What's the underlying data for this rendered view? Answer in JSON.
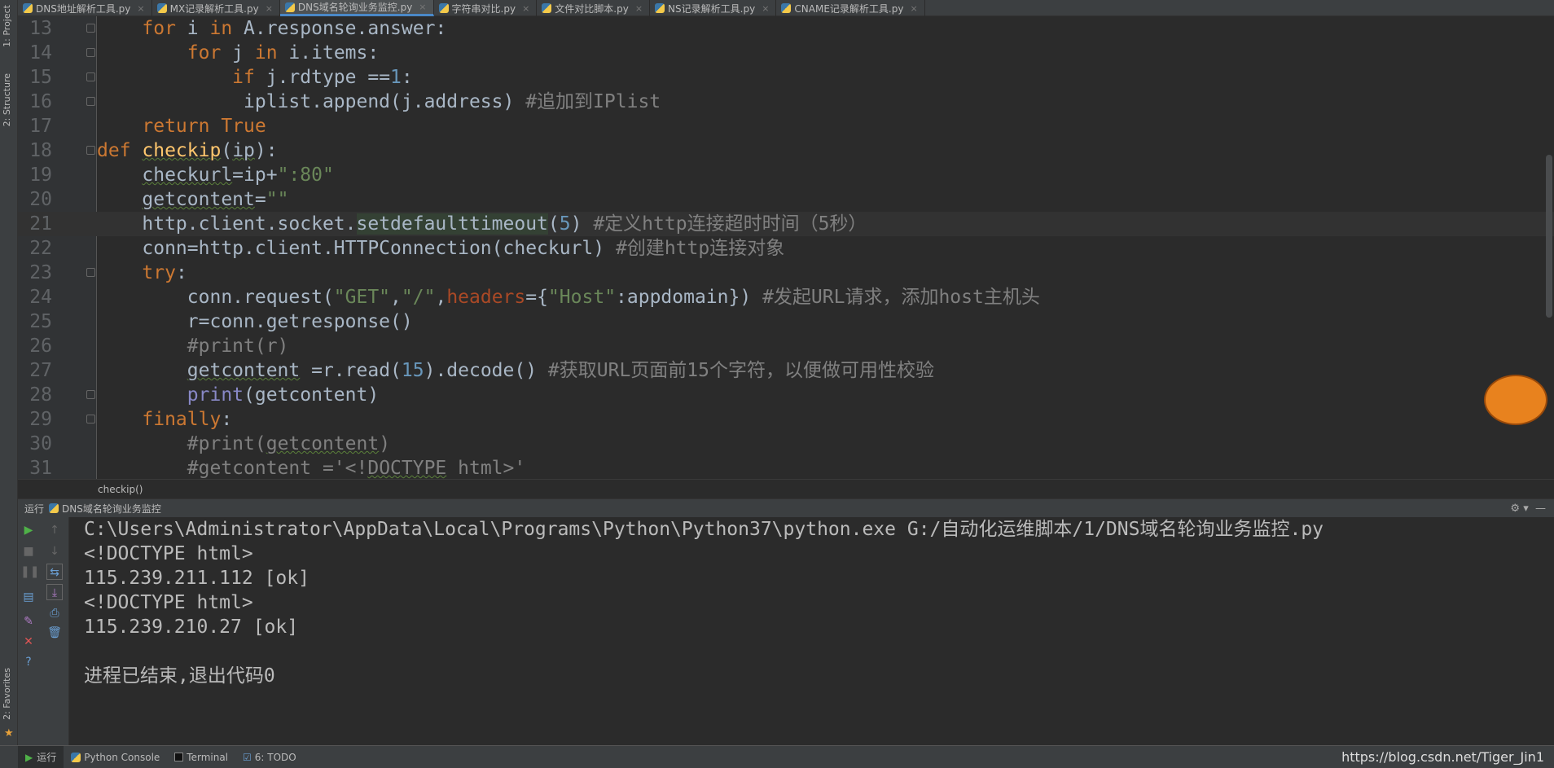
{
  "tool_windows": {
    "project": "1: Project",
    "structure": "2: Structure",
    "favorites": "2: Favorites"
  },
  "tabs": [
    {
      "label": "DNS地址解析工具.py",
      "active": false
    },
    {
      "label": "MX记录解析工具.py",
      "active": false
    },
    {
      "label": "DNS域名轮询业务监控.py",
      "active": true
    },
    {
      "label": "字符串对比.py",
      "active": false
    },
    {
      "label": "文件对比脚本.py",
      "active": false
    },
    {
      "label": "NS记录解析工具.py",
      "active": false
    },
    {
      "label": "CNAME记录解析工具.py",
      "active": false
    }
  ],
  "editor": {
    "current_line": 21,
    "lines": [
      {
        "n": "13",
        "fold": true,
        "tokens": [
          [
            "",
            "    "
          ],
          [
            "k",
            "for"
          ],
          [
            "",
            " i "
          ],
          [
            "k",
            "in"
          ],
          [
            "",
            " A.response.answer:"
          ]
        ]
      },
      {
        "n": "14",
        "fold": true,
        "tokens": [
          [
            "",
            "        "
          ],
          [
            "k",
            "for"
          ],
          [
            "",
            " j "
          ],
          [
            "k",
            "in"
          ],
          [
            "",
            " i.items:"
          ]
        ]
      },
      {
        "n": "15",
        "fold": true,
        "tokens": [
          [
            "",
            "            "
          ],
          [
            "k",
            "if"
          ],
          [
            "",
            " j.rdtype =="
          ],
          [
            "n",
            "1"
          ],
          [
            "",
            ":"
          ]
        ]
      },
      {
        "n": "16",
        "fold": true,
        "tokens": [
          [
            "",
            "             iplist.append(j.address) "
          ],
          [
            "c",
            "#追加到IPlist"
          ]
        ]
      },
      {
        "n": "17",
        "fold": false,
        "tokens": [
          [
            "",
            "    "
          ],
          [
            "k",
            "return True"
          ]
        ]
      },
      {
        "n": "18",
        "fold": true,
        "tokens": [
          [
            "k",
            "def "
          ],
          [
            "f u",
            "checkip"
          ],
          [
            "",
            "("
          ],
          [
            "u",
            "ip"
          ],
          [
            "",
            "):"
          ]
        ]
      },
      {
        "n": "19",
        "fold": false,
        "tokens": [
          [
            "",
            "    "
          ],
          [
            "u",
            "checkurl"
          ],
          [
            "",
            "=ip+"
          ],
          [
            "s",
            "\":80\""
          ]
        ]
      },
      {
        "n": "20",
        "fold": false,
        "tokens": [
          [
            "",
            "    "
          ],
          [
            "u",
            "getcontent"
          ],
          [
            "",
            "="
          ],
          [
            "s",
            "\"\""
          ]
        ]
      },
      {
        "n": "21",
        "fold": false,
        "tokens": [
          [
            "",
            "    http.client.socket."
          ],
          [
            "hl",
            "setdefaulttimeout"
          ],
          [
            "",
            "("
          ],
          [
            "n",
            "5"
          ],
          [
            "",
            ") "
          ],
          [
            "c",
            "#定义http连接超时时间（5秒）"
          ]
        ]
      },
      {
        "n": "22",
        "fold": false,
        "tokens": [
          [
            "",
            "    conn=http.client.HTTPConnection(checkurl) "
          ],
          [
            "c",
            "#创建http连接对象"
          ]
        ]
      },
      {
        "n": "23",
        "fold": true,
        "tokens": [
          [
            "",
            "    "
          ],
          [
            "k",
            "try"
          ],
          [
            "",
            ":"
          ]
        ]
      },
      {
        "n": "24",
        "fold": false,
        "tokens": [
          [
            "",
            "        conn.request("
          ],
          [
            "s",
            "\"GET\""
          ],
          [
            "",
            ","
          ],
          [
            "s",
            "\"/\""
          ],
          [
            "",
            ","
          ],
          [
            "p",
            "headers"
          ],
          [
            "",
            "={"
          ],
          [
            "s",
            "\"Host\""
          ],
          [
            "",
            ":appdomain}) "
          ],
          [
            "c",
            "#发起URL请求，添加host主机头"
          ]
        ]
      },
      {
        "n": "25",
        "fold": false,
        "tokens": [
          [
            "",
            "        r=conn.getresponse()"
          ]
        ]
      },
      {
        "n": "26",
        "fold": false,
        "tokens": [
          [
            "",
            "        "
          ],
          [
            "c",
            "#print(r)"
          ]
        ]
      },
      {
        "n": "27",
        "fold": false,
        "tokens": [
          [
            "",
            "        "
          ],
          [
            "u",
            "getcontent"
          ],
          [
            "",
            " =r.read("
          ],
          [
            "n",
            "15"
          ],
          [
            "",
            ").decode() "
          ],
          [
            "c",
            "#获取URL页面前15个字符，以便做可用性校验"
          ]
        ]
      },
      {
        "n": "28",
        "fold": true,
        "tokens": [
          [
            "",
            "        "
          ],
          [
            "b",
            "print"
          ],
          [
            "",
            "(getcontent)"
          ]
        ]
      },
      {
        "n": "29",
        "fold": true,
        "tokens": [
          [
            "",
            "    "
          ],
          [
            "k",
            "finally"
          ],
          [
            "",
            ":"
          ]
        ]
      },
      {
        "n": "30",
        "fold": false,
        "tokens": [
          [
            "",
            "        "
          ],
          [
            "c",
            "#print("
          ],
          [
            "c u",
            "getcontent"
          ],
          [
            "c",
            ")"
          ]
        ]
      },
      {
        "n": "31",
        "fold": false,
        "tokens": [
          [
            "",
            "        "
          ],
          [
            "c",
            "#getcontent ='<!"
          ],
          [
            "c u",
            "DOCTYPE"
          ],
          [
            "c",
            " html>'"
          ]
        ]
      }
    ]
  },
  "breadcrumb": "checkip()",
  "run": {
    "label": "运行",
    "config": "DNS域名轮询业务监控"
  },
  "console": [
    "C:\\Users\\Administrator\\AppData\\Local\\Programs\\Python\\Python37\\python.exe G:/自动化运维脚本/1/DNS域名轮询业务监控.py",
    "<!DOCTYPE html>",
    "115.239.211.112 [ok]",
    "<!DOCTYPE html>",
    "115.239.210.27 [ok]",
    "",
    "进程已结束,退出代码0"
  ],
  "bottom": {
    "run": "运行",
    "python_console": "Python Console",
    "terminal": "Terminal",
    "todo": "6: TODO"
  },
  "watermark": "https://blog.csdn.net/Tiger_Jin1",
  "colors": {
    "keyword": "#cc7832",
    "string": "#6a8759",
    "comment": "#808080",
    "number": "#6897bb",
    "function": "#ffc66d",
    "accent": "#4a88c7"
  }
}
